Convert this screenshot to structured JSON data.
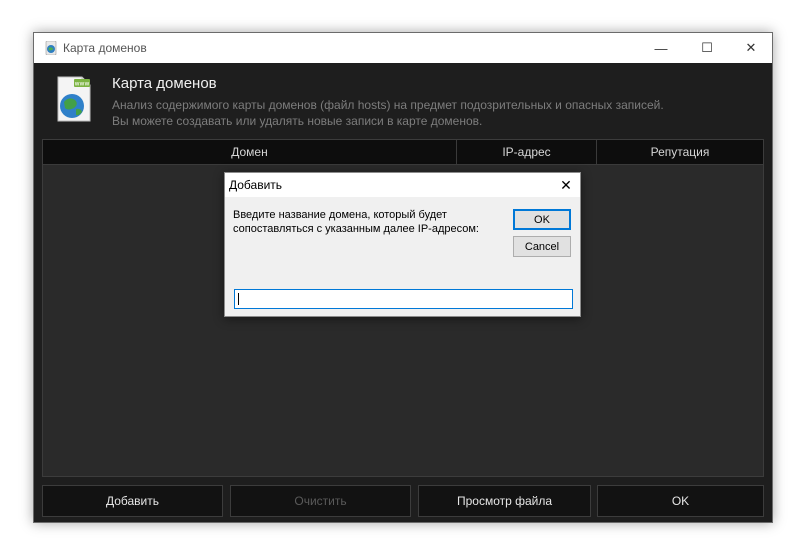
{
  "window": {
    "title": "Карта доменов",
    "controls": {
      "minimize": "—",
      "maximize": "☐",
      "close": "✕"
    }
  },
  "header": {
    "icon": "www-globe-icon",
    "icon_label": "www",
    "title": "Карта доменов",
    "description_line1": "Анализ содержимого карты доменов (файл hosts) на предмет подозрительных и опасных записей.",
    "description_line2": "Вы можете создавать или удалять новые записи в карте доменов."
  },
  "table": {
    "columns": [
      "Домен",
      "IP-адрес",
      "Репутация"
    ],
    "rows": []
  },
  "buttons": {
    "add": "Добавить",
    "clear": "Очистить",
    "view_file": "Просмотр файла",
    "ok": "OK"
  },
  "dialog": {
    "title": "Добавить",
    "close": "✕",
    "prompt": "Введите название домена, который будет сопоставляться с указанным далее IP-адресом:",
    "ok": "OK",
    "cancel": "Cancel",
    "input_value": ""
  },
  "colors": {
    "accent": "#0078d7",
    "window_bg": "#1e1e1e",
    "dialog_bg": "#f0f0f0"
  }
}
